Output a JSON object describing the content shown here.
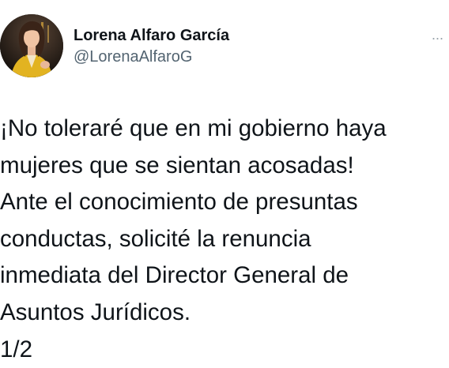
{
  "tweet": {
    "author": {
      "display_name": "Lorena Alfaro García",
      "handle": "@LorenaAlfaroG",
      "avatar_icon": "profile-photo"
    },
    "more_icon": "more-horizontal-icon",
    "more_symbol": "···",
    "text_lines": [
      "¡No toleraré que en mi gobierno haya",
      "mujeres que se sientan acosadas!",
      "Ante el conocimiento de presuntas",
      "conductas, solicité la renuncia",
      "inmediata del Director General de",
      "Asuntos Jurídicos.",
      "1/2"
    ]
  }
}
